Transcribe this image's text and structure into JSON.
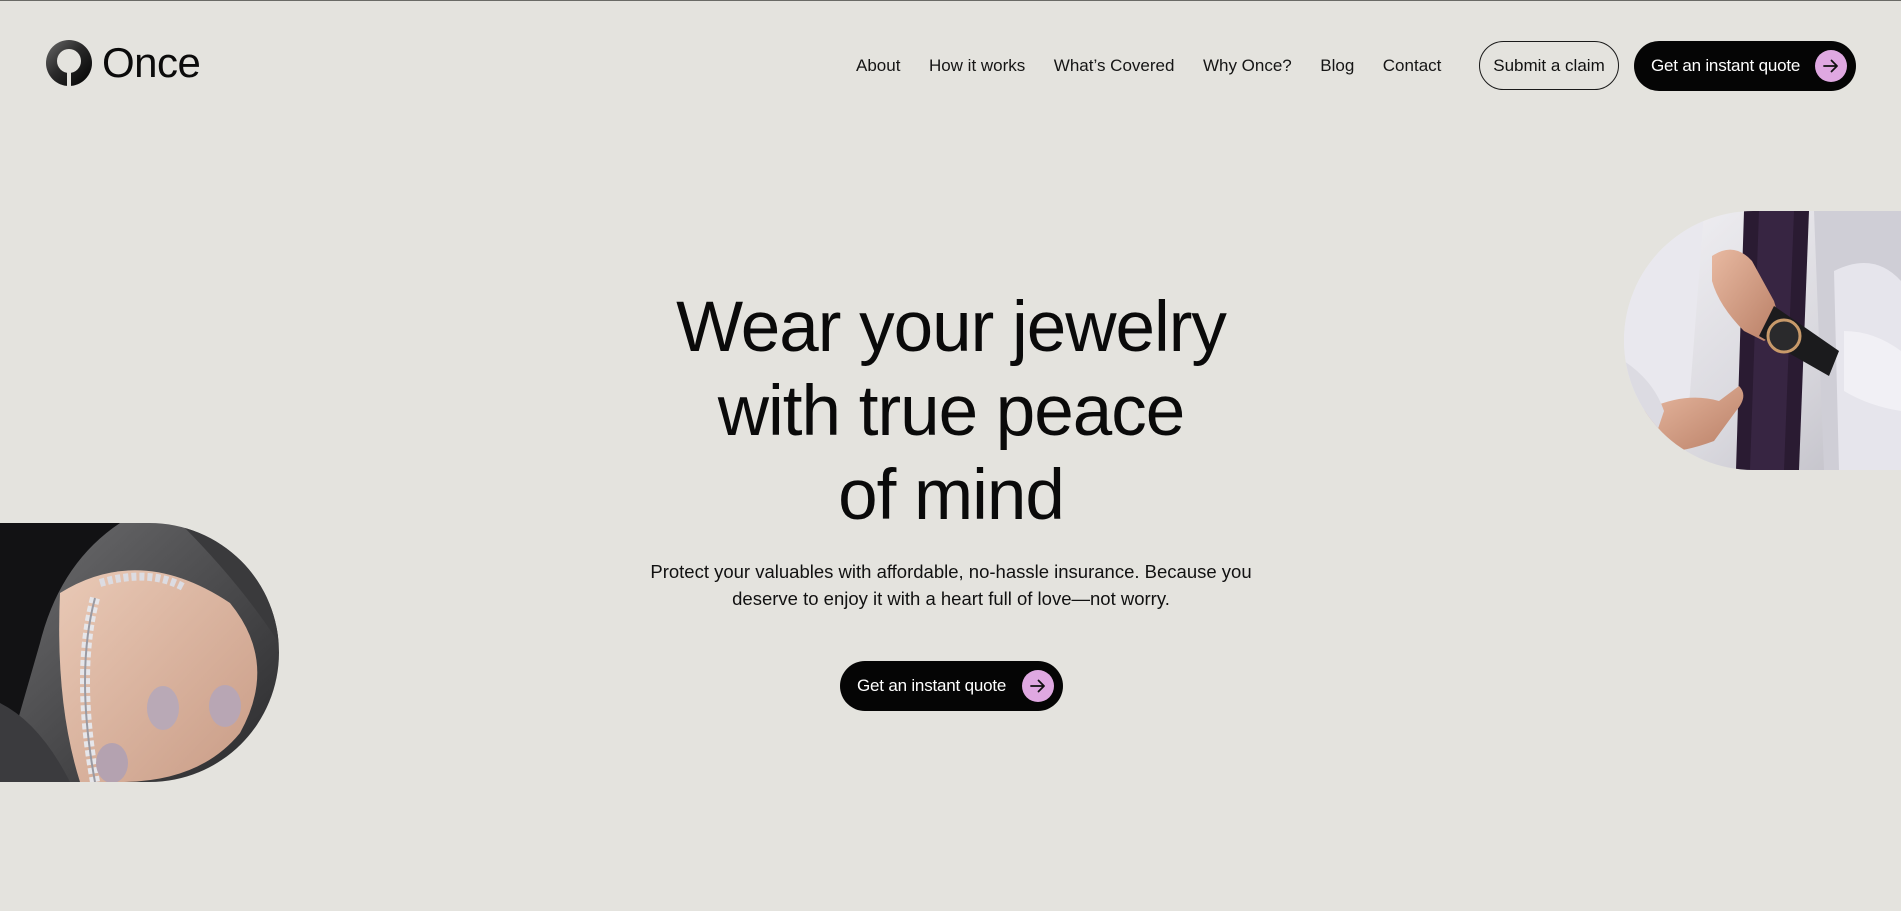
{
  "brand": {
    "name": "Once"
  },
  "nav": {
    "items": [
      {
        "label": "About"
      },
      {
        "label": "How it works"
      },
      {
        "label": "What’s Covered"
      },
      {
        "label": "Why Once?"
      },
      {
        "label": "Blog"
      },
      {
        "label": "Contact"
      }
    ]
  },
  "header_actions": {
    "claim_label": "Submit a claim",
    "quote_label": "Get an instant quote"
  },
  "hero": {
    "title": "Wear your jewelry\nwith true peace\nof mind",
    "subtitle": "Protect your valuables with affordable, no-hassle insurance. Because you deserve to enjoy it with a heart full of love—not worry.",
    "cta_label": "Get an instant quote"
  },
  "images": {
    "left": "bracelet-on-wrist-photo",
    "right": "man-adjusting-watch-photo"
  },
  "colors": {
    "background": "#e4e3de",
    "button_dark": "#050505",
    "accent": "#dfa8e1",
    "text": "#0c0c0c"
  },
  "icons": {
    "logo": "ring-logo-icon",
    "arrow": "arrow-right-icon"
  }
}
